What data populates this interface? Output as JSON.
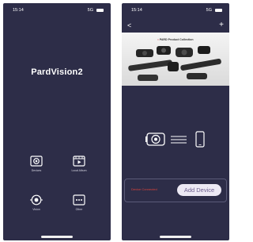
{
  "home": {
    "status": {
      "time": "15:14",
      "signal": "5G"
    },
    "title": "PardVision2",
    "tiles": [
      {
        "label": "Devices",
        "icon": "camera-icon"
      },
      {
        "label": "Local Album",
        "icon": "video-play-icon"
      },
      {
        "label": "Vision",
        "icon": "eye-icon"
      },
      {
        "label": "Other",
        "icon": "more-icon"
      }
    ]
  },
  "devices": {
    "status": {
      "time": "15:14",
      "signal": "5G"
    },
    "nav": {
      "back": "<",
      "add": "+"
    },
    "banner": {
      "mark": "•",
      "title": "PARD Product Collection"
    },
    "connection_status": "Device Connected",
    "add_button": "Add Device"
  }
}
